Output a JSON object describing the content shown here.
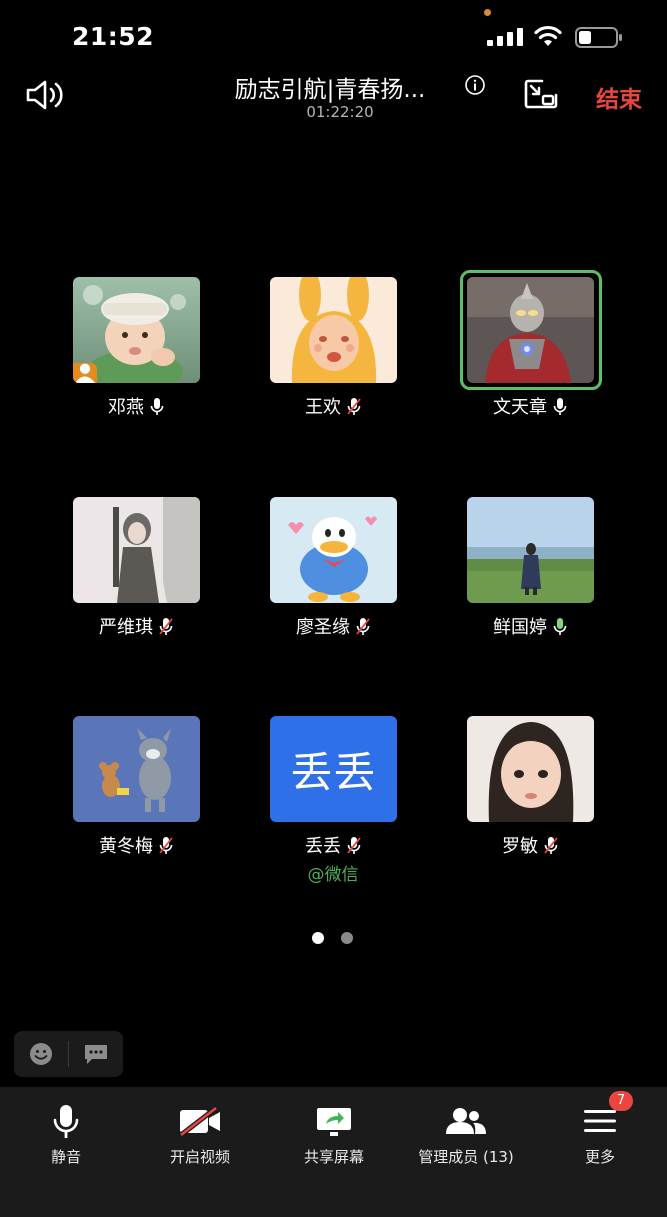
{
  "status_bar": {
    "time": "21:52"
  },
  "header": {
    "title": "励志引航|青春扬...",
    "timer": "01:22:20",
    "end_label": "结束"
  },
  "participants": [
    {
      "name": "邓燕",
      "mic": "on",
      "host": true,
      "speaking": false
    },
    {
      "name": "王欢",
      "mic": "muted",
      "host": false,
      "speaking": false
    },
    {
      "name": "文天章",
      "mic": "on",
      "host": false,
      "speaking": true
    },
    {
      "name": "严维琪",
      "mic": "muted",
      "host": false,
      "speaking": false
    },
    {
      "name": "廖圣缘",
      "mic": "muted",
      "host": false,
      "speaking": false
    },
    {
      "name": "鲜国婷",
      "mic": "on",
      "host": false,
      "speaking": false
    },
    {
      "name": "黄冬梅",
      "mic": "muted",
      "host": false,
      "speaking": false
    },
    {
      "name": "丢丢",
      "mic": "muted",
      "host": false,
      "speaking": false,
      "avatar_text": "丢丢",
      "tag": "@微信"
    },
    {
      "name": "罗敏",
      "mic": "muted",
      "host": false,
      "speaking": false
    }
  ],
  "pagination": {
    "current": 1,
    "total": 2
  },
  "toolbar": {
    "mute_label": "静音",
    "video_label": "开启视频",
    "share_label": "共享屏幕",
    "members_label": "管理成员 (13)",
    "more_label": "更多",
    "more_badge": "7"
  },
  "colors": {
    "background": "#000000",
    "toolbar_bg": "#1b1b1b",
    "end_red": "#e8463f",
    "speaking_green": "#5bbf66",
    "wechat_green": "#4cb05b",
    "text_avatar_blue": "#2f6fe8"
  }
}
